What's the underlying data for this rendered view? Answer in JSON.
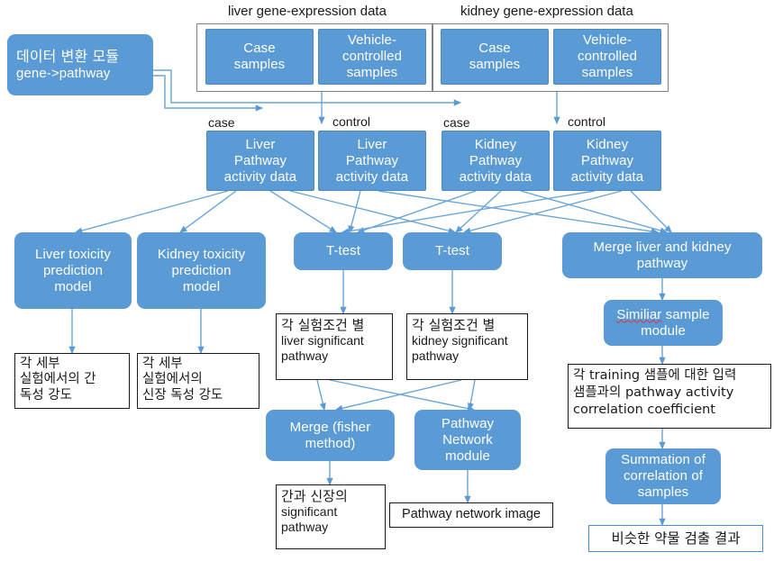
{
  "theme": {
    "blue": "#5b9bd5",
    "arrow": "#4a90c8",
    "text_dark": "#1a1a1a",
    "white": "#ffffff"
  },
  "captions": {
    "liver_gene": "liver gene-expression data",
    "kidney_gene": "kidney gene-expression data",
    "case_1": "case",
    "control_1": "control",
    "case_2": "case",
    "control_2": "control"
  },
  "nodes": {
    "transform_module": {
      "line1": "데이터 변환 모듈",
      "line2": "gene->pathway"
    },
    "liver_case": "Case\nsamples",
    "liver_vehicle": "Vehicle-\ncontrolled\nsamples",
    "kidney_case": "Case\nsamples",
    "kidney_vehicle": "Vehicle-\ncontrolled\nsamples",
    "liver_pathway_case": "Liver\nPathway\nactivity data",
    "liver_pathway_control": "Liver\nPathway\nactivity data",
    "kidney_pathway_case": "Kidney\nPathway\nactivity data",
    "kidney_pathway_control": "Kidney\nPathway\nactivity data",
    "liver_tox_model": "Liver toxicity\nprediction\nmodel",
    "kidney_tox_model": "Kidney toxicity\nprediction\nmodel",
    "ttest_liver": "T-test",
    "ttest_kidney": "T-test",
    "merge_liver_kidney": "Merge liver and kidney\npathway",
    "liver_tox_result": "각 세부\n실험에서의 간\n독성 강도",
    "kidney_tox_result": "각 세부\n실험에서의\n신장 독성 강도",
    "liver_sig_pathway": {
      "kr": "각 실험조건 별",
      "en": "liver significant\npathway"
    },
    "kidney_sig_pathway": {
      "kr": "각 실험조건 별",
      "en": "kidney significant\npathway"
    },
    "similar_sample_module": {
      "misspelled": "Similiar",
      "rest": " sample\nmodule"
    },
    "correlation_box": "각 training 샘플에 대한 입력\n샘플과의 pathway activity\ncorrelation coefficient",
    "merge_fisher": "Merge (fisher\nmethod)",
    "pathway_network_module": "Pathway\nNetwork\nmodule",
    "summation_box": "Summation of\ncorrelation of\nsamples",
    "sig_pathway_result": {
      "kr": "간과 신장의",
      "en": "significant\npathway"
    },
    "pathway_network_image": "Pathway network image",
    "drug_detection_result": "비슷한 약물 검출 결과"
  }
}
